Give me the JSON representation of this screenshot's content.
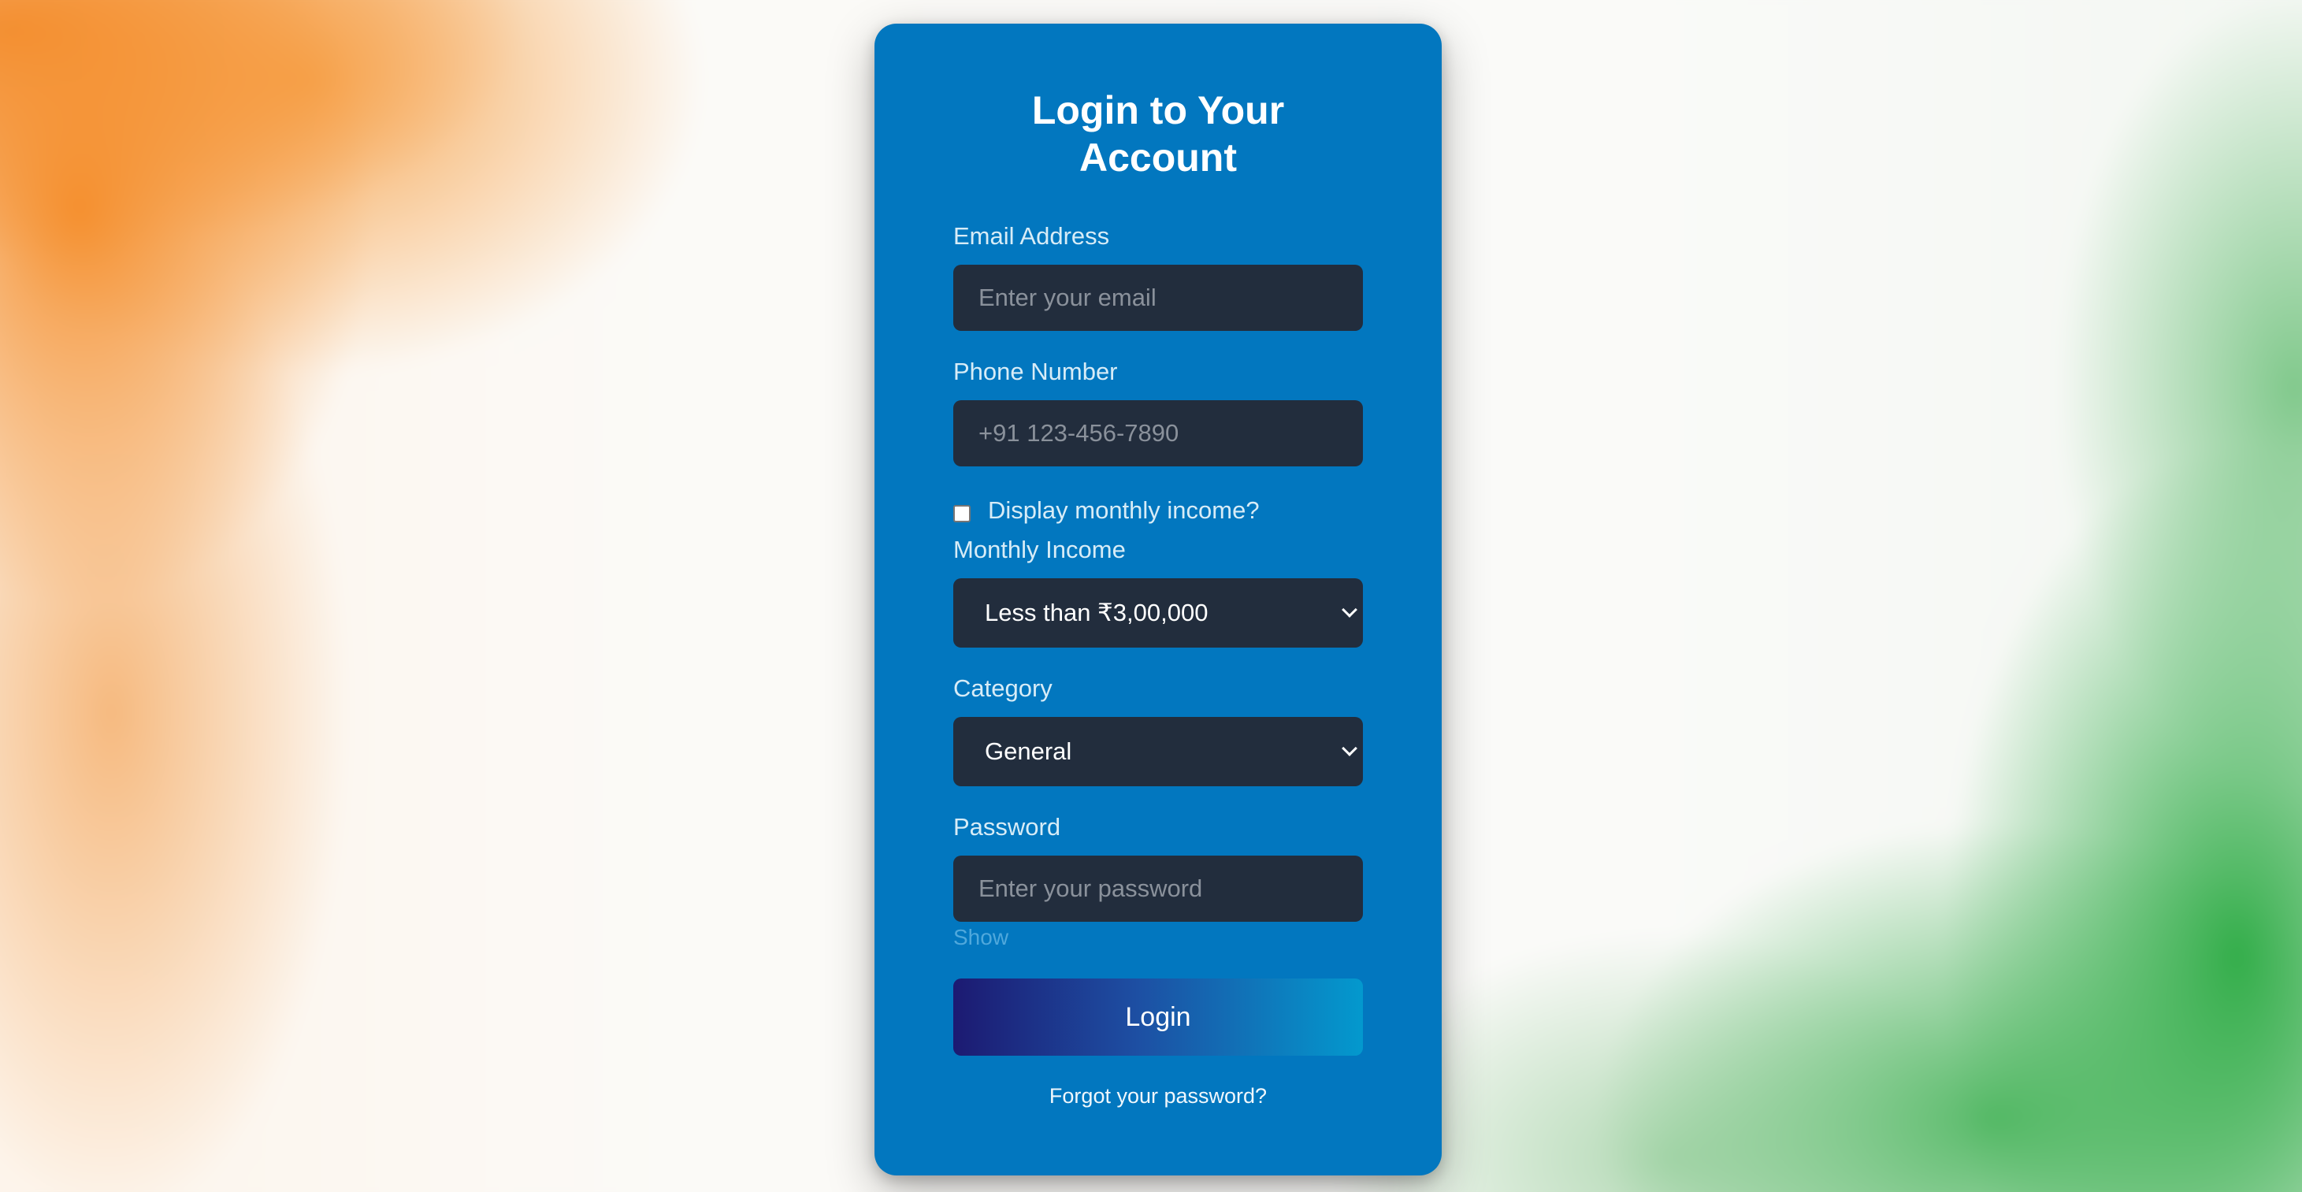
{
  "form": {
    "title": "Login to Your Account",
    "email": {
      "label": "Email Address",
      "placeholder": "Enter your email",
      "value": ""
    },
    "phone": {
      "label": "Phone Number",
      "placeholder": "+91 123-456-7890",
      "value": ""
    },
    "income_toggle": {
      "label": "Display monthly income?",
      "checked": false
    },
    "income": {
      "label": "Monthly Income",
      "selected": "Less than ₹3,00,000"
    },
    "category": {
      "label": "Category",
      "selected": "General"
    },
    "password": {
      "label": "Password",
      "placeholder": "Enter your password",
      "value": "",
      "show_label": "Show"
    },
    "login_label": "Login",
    "forgot_label": "Forgot your password?"
  },
  "colors": {
    "card": "#0277bf",
    "field_bg": "#222d3d",
    "button_gradient_start": "#1c1a72",
    "button_gradient_end": "#0399ce",
    "bg_saffron": "#f48c28",
    "bg_green": "#2aaa42"
  },
  "icons": {
    "dropdown": "chevron-down-icon",
    "checkbox": "checkbox-icon"
  }
}
